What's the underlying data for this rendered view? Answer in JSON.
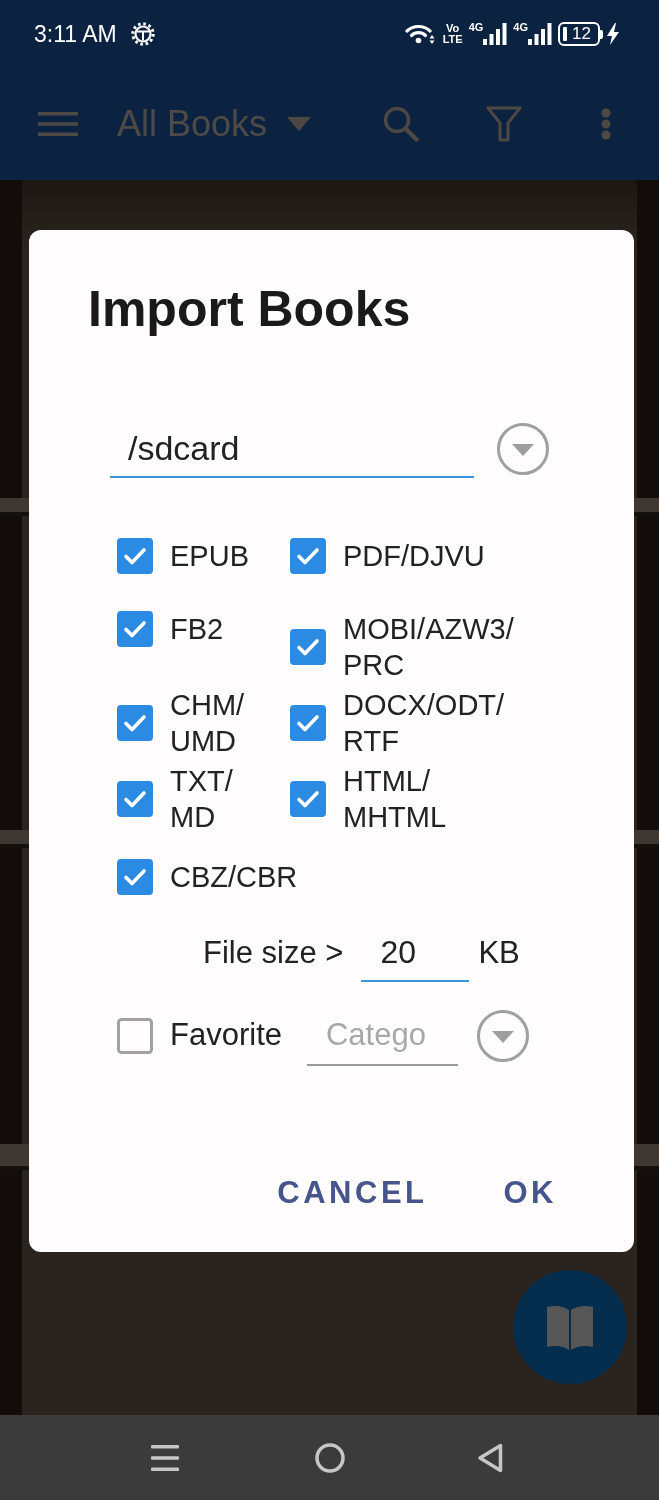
{
  "status_bar": {
    "time": "3:11 AM",
    "volte": [
      "Vo",
      "LTE"
    ],
    "networks": [
      "4G",
      "4G"
    ],
    "battery": "12"
  },
  "app_bar": {
    "title": "All Books"
  },
  "dialog": {
    "title": "Import Books",
    "folder": {
      "value": "/sdcard"
    },
    "formats": [
      {
        "label": "EPUB",
        "checked": true
      },
      {
        "label": "PDF/DJVU",
        "checked": true
      },
      {
        "label": "FB2",
        "checked": true
      },
      {
        "label": "MOBI/AZW3/PRC",
        "checked": true
      },
      {
        "label": "CHM/UMD",
        "checked": true
      },
      {
        "label": "DOCX/ODT/RTF",
        "checked": true
      },
      {
        "label": "TXT/MD",
        "checked": true
      },
      {
        "label": "HTML/MHTML",
        "checked": true
      },
      {
        "label": "CBZ/CBR",
        "checked": true
      }
    ],
    "file_size": {
      "label": "File size >",
      "value": "20",
      "unit": "KB"
    },
    "favorite": {
      "label": "Favorite",
      "checked": false
    },
    "category": {
      "placeholder": "Catego"
    },
    "buttons": [
      "CANCEL",
      "OK"
    ]
  }
}
